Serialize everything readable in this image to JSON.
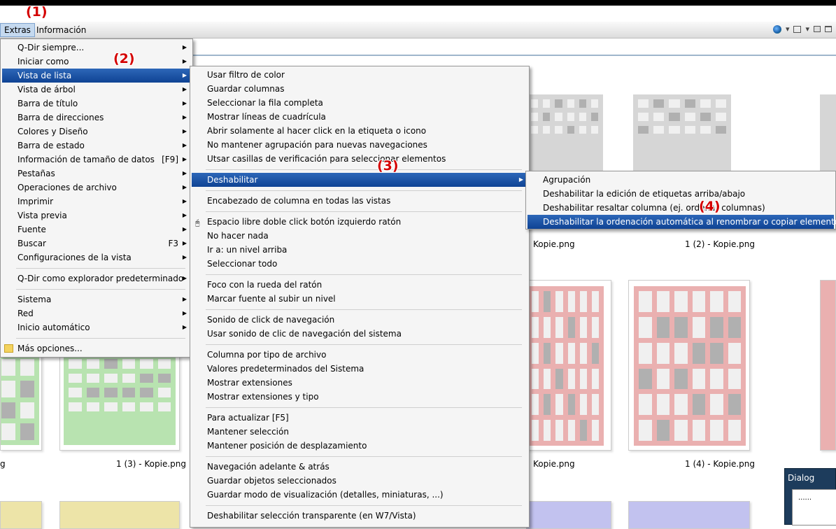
{
  "menubar": {
    "extras": "Extras",
    "informacion": "Información"
  },
  "annotations": {
    "a1": "(1)",
    "a2": "(2)",
    "a3": "(3)",
    "a4": "(4)"
  },
  "files": {
    "f1": "1 (2) - Kopie.png",
    "f2": "1 (3) - Kopie.png",
    "f3": "1 (4) - Kopie.png",
    "kopie1": "Kopie.png",
    "kopie2": "Kopie.png",
    "g": "g"
  },
  "dialog": {
    "title": "Dialog",
    "text": "......"
  },
  "extras_menu": [
    {
      "label": "Q-Dir siempre...",
      "arrow": "▶"
    },
    {
      "label": "Iniciar como",
      "arrow": "▶"
    },
    {
      "label": "Vista de lista",
      "arrow": "▶"
    },
    {
      "label": "Vista de árbol",
      "arrow": "▶"
    },
    {
      "label": "Barra de título",
      "arrow": "▶"
    },
    {
      "label": "Barra de direcciones",
      "arrow": "▶"
    },
    {
      "label": "Colores y Diseño",
      "arrow": "▶"
    },
    {
      "label": "Barra de estado",
      "arrow": "▶"
    },
    {
      "label": "Información de tamaño de datos",
      "shortcut": "[F9]",
      "arrow": "▶"
    },
    {
      "label": "Pestañas",
      "arrow": "▶"
    },
    {
      "label": "Operaciones de archivo",
      "arrow": "▶"
    },
    {
      "label": "Imprimir",
      "arrow": "▶"
    },
    {
      "label": "Vista previa",
      "arrow": "▶"
    },
    {
      "label": "Fuente",
      "arrow": "▶"
    },
    {
      "label": "Buscar",
      "shortcut": "F3",
      "arrow": "▶"
    },
    {
      "label": "Configuraciones de la vista",
      "arrow": "▶"
    },
    {
      "label": "Q-Dir como explorador predeterminado",
      "arrow": "▶"
    },
    {
      "label": "Sistema",
      "arrow": "▶"
    },
    {
      "label": "Red",
      "arrow": "▶"
    },
    {
      "label": "Inicio automático",
      "arrow": "▶"
    },
    {
      "label": "Más opciones..."
    }
  ],
  "list_menu": [
    "Usar filtro de color",
    "Guardar columnas",
    "Seleccionar la fila completa",
    "Mostrar líneas de cuadrícula",
    "Abrir solamente al hacer click en la etiqueta o icono",
    "No mantener agrupación para nuevas navegaciones",
    "Utsar casillas de verificación para seleccionar elementos",
    "Deshabilitar",
    "Encabezado de columna en todas las vistas",
    "Espacio libre doble click botón izquierdo ratón",
    "No hacer nada",
    "Ir a: un nivel arriba",
    "Seleccionar todo",
    "Foco con la rueda del ratón",
    "Marcar fuente al subir un nivel",
    "Sonido de click de navegación",
    "Usar sonido de clic de navegación del sistema",
    "Columna por tipo de archivo",
    "Valores predeterminados del Sistema",
    "Mostrar extensiones",
    "Mostrar extensiones y tipo",
    "Para actualizar [F5]",
    "Mantener selección",
    "Mantener posición de desplazamiento",
    "Navegación adelante & atrás",
    "Guardar objetos seleccionados",
    "Guardar modo de visualización (detalles, miniaturas, ...)",
    "Deshabilitar selección transparente (en W7/Vista)"
  ],
  "list_menu_arrow": "▶",
  "disable_menu": [
    "Agrupación",
    "Deshabilitar la edición de etiquetas arriba/abajo",
    "Deshabilitar resaltar columna (ej. ordenar columnas)",
    "Deshabilitar la ordenación automática al renombrar o copiar elementos"
  ],
  "colors": {
    "highlight": "#0f4394",
    "annotation": "#d40000"
  }
}
